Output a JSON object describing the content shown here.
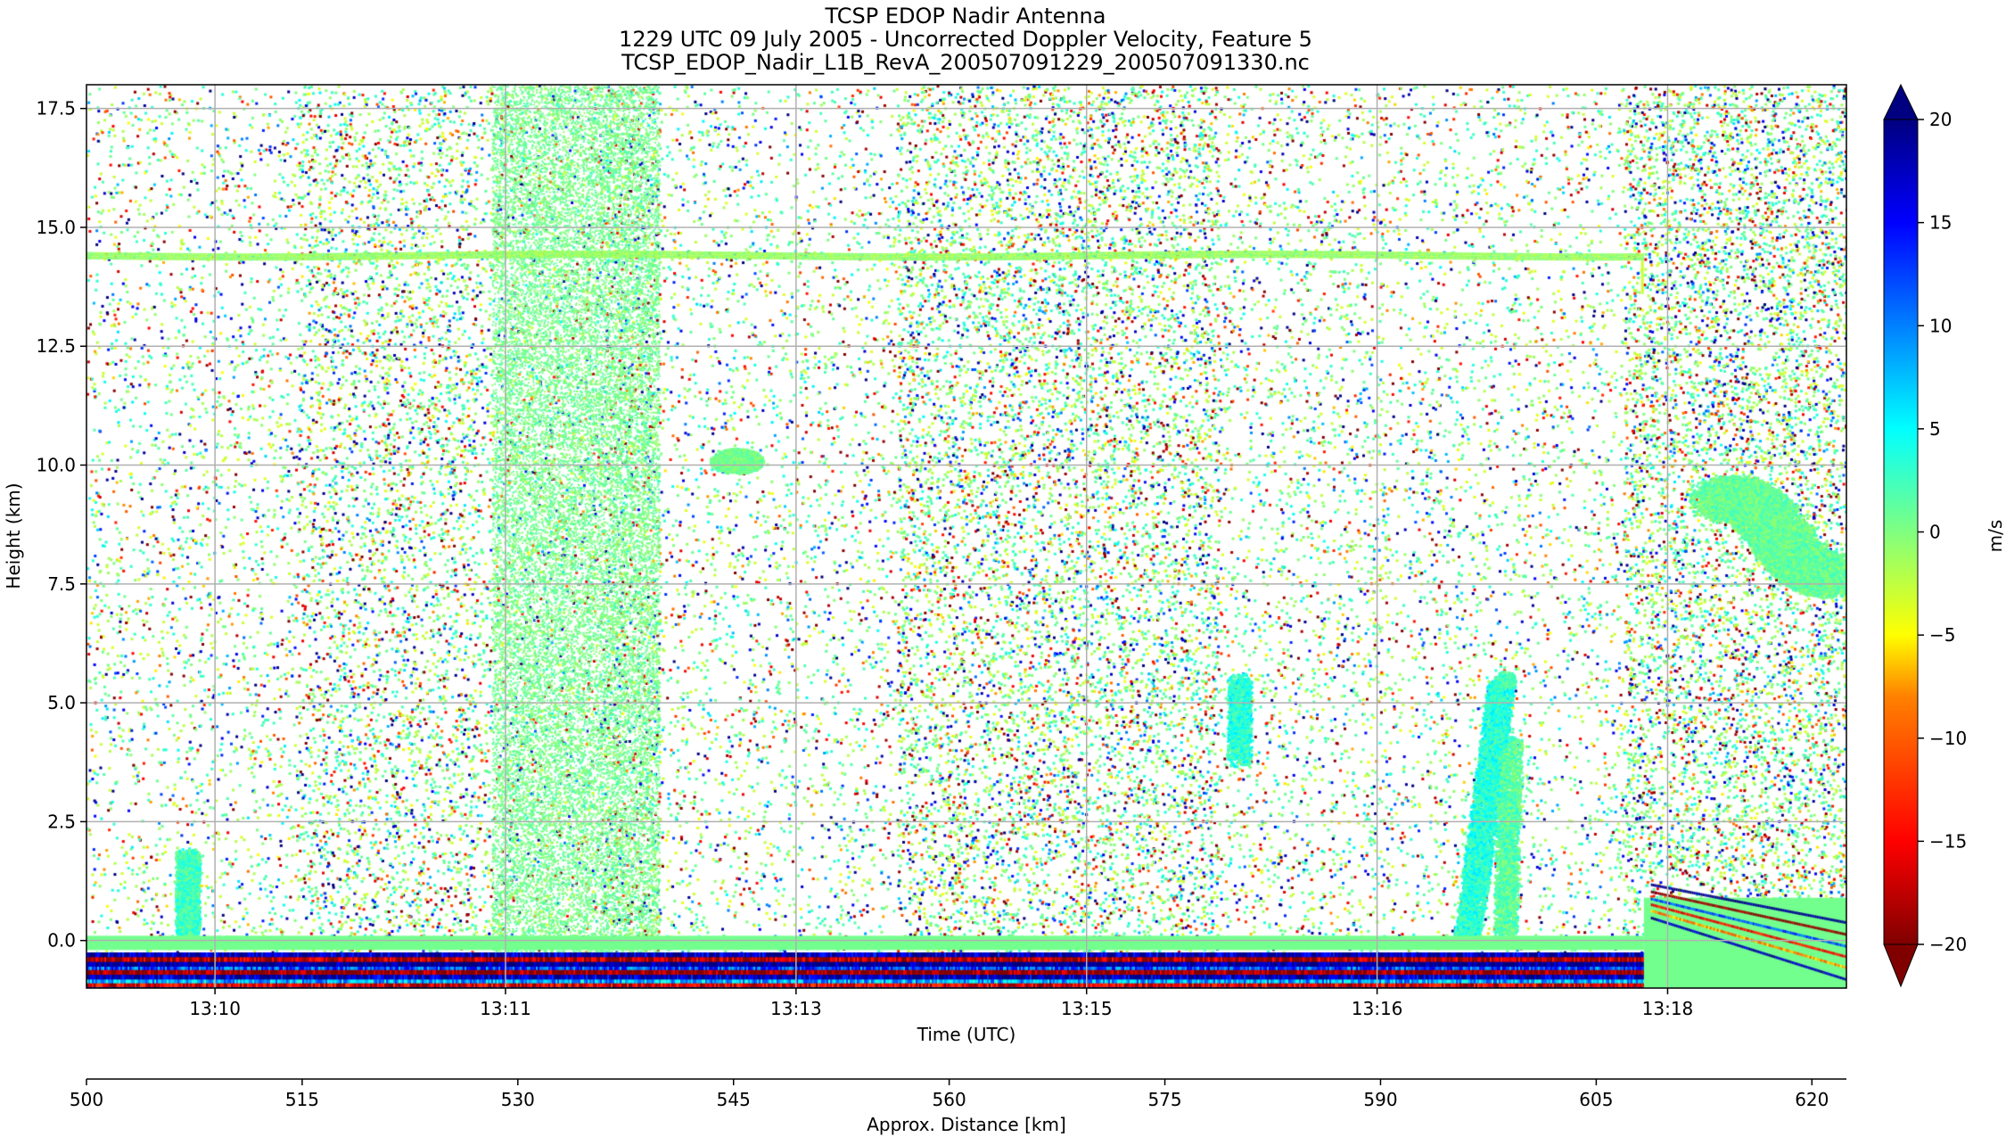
{
  "chart_data": {
    "type": "heatmap",
    "title": [
      "TCSP EDOP Nadir Antenna",
      "1229 UTC 09 July 2005 - Uncorrected Doppler Velocity, Feature 5",
      "TCSP_EDOP_Nadir_L1B_RevA_200507091229_200507091330.nc"
    ],
    "xlabel": "Time (UTC)",
    "ylabel": "Height (km)",
    "x2label": "Approx. Distance [km]",
    "colorbar_label": "m/s",
    "ylim": [
      -1.0,
      18.0
    ],
    "yticks": [
      0.0,
      2.5,
      5.0,
      7.5,
      10.0,
      12.5,
      15.0,
      17.5
    ],
    "ytick_labels": [
      "0.0",
      "2.5",
      "5.0",
      "7.5",
      "10.0",
      "12.5",
      "15.0",
      "17.5"
    ],
    "xlim": [
      497.0,
      623.0
    ],
    "time_ticks": [
      {
        "label": "13:10",
        "at_km": 506.2
      },
      {
        "label": "13:11",
        "at_km": 527.0
      },
      {
        "label": "13:13",
        "at_km": 547.8
      },
      {
        "label": "13:15",
        "at_km": 568.6
      },
      {
        "label": "13:16",
        "at_km": 589.4
      },
      {
        "label": "13:18",
        "at_km": 610.2
      }
    ],
    "distance_ticks": [
      500,
      515,
      530,
      545,
      560,
      575,
      590,
      605,
      620
    ],
    "distance_tick_labels": [
      "500",
      "515",
      "530",
      "545",
      "560",
      "575",
      "590",
      "605",
      "620"
    ],
    "colorbar": {
      "min": -20,
      "max": 20,
      "ticks": [
        -20,
        -15,
        -10,
        -5,
        0,
        5,
        10,
        15,
        20
      ],
      "tick_labels": [
        "−20",
        "−15",
        "−10",
        "−5",
        "0",
        "5",
        "10",
        "15",
        "20"
      ],
      "extend": "both",
      "colormap": "jet_r",
      "colors": [
        "#800000",
        "#ff0000",
        "#ff8000",
        "#ffff00",
        "#80ff80",
        "#00ffff",
        "#0080ff",
        "#0000ff",
        "#000080"
      ]
    },
    "grid": true
  }
}
